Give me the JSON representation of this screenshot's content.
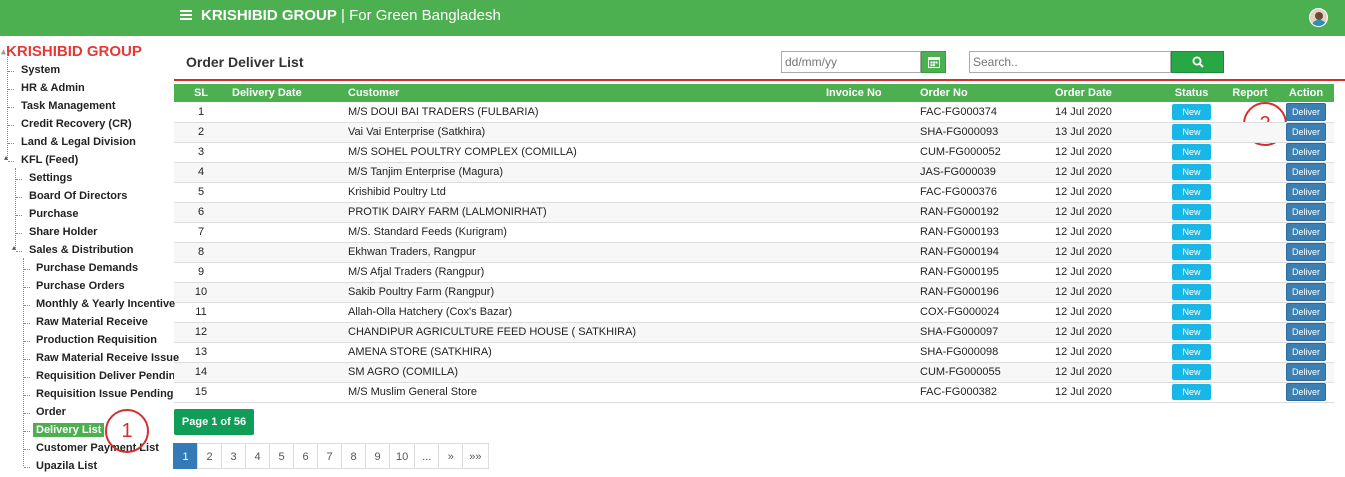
{
  "header": {
    "brand_bold": "KRISHIBID GROUP",
    "brand_rest": " | For Green Bangladesh",
    "menu_icon": "hamburger-icon",
    "avatar_icon": "user-avatar",
    "color": "#4caf50"
  },
  "sidebar": {
    "root": "KRISHIBID GROUP",
    "top_items": [
      "System",
      "HR & Admin",
      "Task Management",
      "Credit Recovery (CR)",
      "Land & Legal Division",
      "KFL (Feed)"
    ],
    "kfl_items": [
      "Settings",
      "Board Of Directors",
      "Purchase",
      "Share Holder",
      "Sales & Distribution"
    ],
    "sales_items": [
      "Purchase Demands",
      "Purchase Orders",
      "Monthly & Yearly Incentive",
      "Raw Material Receive",
      "Production Requisition",
      "Raw Material Receive Issue",
      "Requisition Deliver Pending",
      "Requisition Issue Pending",
      "Order",
      "Delivery List",
      "Customer Payment List",
      "Upazila List"
    ],
    "active_item": "Delivery List"
  },
  "annotations": {
    "one": "1",
    "two": "2"
  },
  "main": {
    "title": "Order Deliver List",
    "date_placeholder": "dd/mm/yy",
    "search_placeholder": "Search..",
    "calendar_icon": "calendar-icon",
    "search_icon": "search-icon"
  },
  "table": {
    "columns": [
      "SL",
      "Delivery Date",
      "Customer",
      "Invoice No",
      "Order No",
      "Order Date",
      "Status",
      "Report",
      "Action"
    ],
    "rows": [
      {
        "sl": "1",
        "delivery_date": "",
        "customer": "M/S DOUI BAI TRADERS (FULBARIA)",
        "invoice": "",
        "order_no": "FAC-FG000374",
        "order_date": "14 Jul 2020",
        "status": "New",
        "report": "",
        "action": "Deliver"
      },
      {
        "sl": "2",
        "delivery_date": "",
        "customer": "Vai Vai Enterprise (Satkhira)",
        "invoice": "",
        "order_no": "SHA-FG000093",
        "order_date": "13 Jul 2020",
        "status": "New",
        "report": "",
        "action": "Deliver"
      },
      {
        "sl": "3",
        "delivery_date": "",
        "customer": "M/S SOHEL POULTRY COMPLEX (COMILLA)",
        "invoice": "",
        "order_no": "CUM-FG000052",
        "order_date": "12 Jul 2020",
        "status": "New",
        "report": "",
        "action": "Deliver"
      },
      {
        "sl": "4",
        "delivery_date": "",
        "customer": "M/S Tanjim Enterprise (Magura)",
        "invoice": "",
        "order_no": "JAS-FG000039",
        "order_date": "12 Jul 2020",
        "status": "New",
        "report": "",
        "action": "Deliver"
      },
      {
        "sl": "5",
        "delivery_date": "",
        "customer": "Krishibid Poultry Ltd",
        "invoice": "",
        "order_no": "FAC-FG000376",
        "order_date": "12 Jul 2020",
        "status": "New",
        "report": "",
        "action": "Deliver"
      },
      {
        "sl": "6",
        "delivery_date": "",
        "customer": "PROTIK DAIRY FARM (LALMONIRHAT)",
        "invoice": "",
        "order_no": "RAN-FG000192",
        "order_date": "12 Jul 2020",
        "status": "New",
        "report": "",
        "action": "Deliver"
      },
      {
        "sl": "7",
        "delivery_date": "",
        "customer": "M/S. Standard Feeds (Kurigram)",
        "invoice": "",
        "order_no": "RAN-FG000193",
        "order_date": "12 Jul 2020",
        "status": "New",
        "report": "",
        "action": "Deliver"
      },
      {
        "sl": "8",
        "delivery_date": "",
        "customer": "Ekhwan Traders, Rangpur",
        "invoice": "",
        "order_no": "RAN-FG000194",
        "order_date": "12 Jul 2020",
        "status": "New",
        "report": "",
        "action": "Deliver"
      },
      {
        "sl": "9",
        "delivery_date": "",
        "customer": "M/S Afjal Traders (Rangpur)",
        "invoice": "",
        "order_no": "RAN-FG000195",
        "order_date": "12 Jul 2020",
        "status": "New",
        "report": "",
        "action": "Deliver"
      },
      {
        "sl": "10",
        "delivery_date": "",
        "customer": "Sakib Poultry Farm (Rangpur)",
        "invoice": "",
        "order_no": "RAN-FG000196",
        "order_date": "12 Jul 2020",
        "status": "New",
        "report": "",
        "action": "Deliver"
      },
      {
        "sl": "11",
        "delivery_date": "",
        "customer": "Allah-Olla Hatchery (Cox's Bazar)",
        "invoice": "",
        "order_no": "COX-FG000024",
        "order_date": "12 Jul 2020",
        "status": "New",
        "report": "",
        "action": "Deliver"
      },
      {
        "sl": "12",
        "delivery_date": "",
        "customer": "CHANDIPUR AGRICULTURE FEED HOUSE ( SATKHIRA)",
        "invoice": "",
        "order_no": "SHA-FG000097",
        "order_date": "12 Jul 2020",
        "status": "New",
        "report": "",
        "action": "Deliver"
      },
      {
        "sl": "13",
        "delivery_date": "",
        "customer": "AMENA STORE (SATKHIRA)",
        "invoice": "",
        "order_no": "SHA-FG000098",
        "order_date": "12 Jul 2020",
        "status": "New",
        "report": "",
        "action": "Deliver"
      },
      {
        "sl": "14",
        "delivery_date": "",
        "customer": "SM AGRO (COMILLA)",
        "invoice": "",
        "order_no": "CUM-FG000055",
        "order_date": "12 Jul 2020",
        "status": "New",
        "report": "",
        "action": "Deliver"
      },
      {
        "sl": "15",
        "delivery_date": "",
        "customer": "M/S Muslim General Store",
        "invoice": "",
        "order_no": "FAC-FG000382",
        "order_date": "12 Jul 2020",
        "status": "New",
        "report": "",
        "action": "Deliver"
      }
    ]
  },
  "pagination": {
    "indicator": "Page 1 of 56",
    "pages": [
      "1",
      "2",
      "3",
      "4",
      "5",
      "6",
      "7",
      "8",
      "9",
      "10",
      "...",
      "»",
      "»»"
    ],
    "current": "1"
  }
}
